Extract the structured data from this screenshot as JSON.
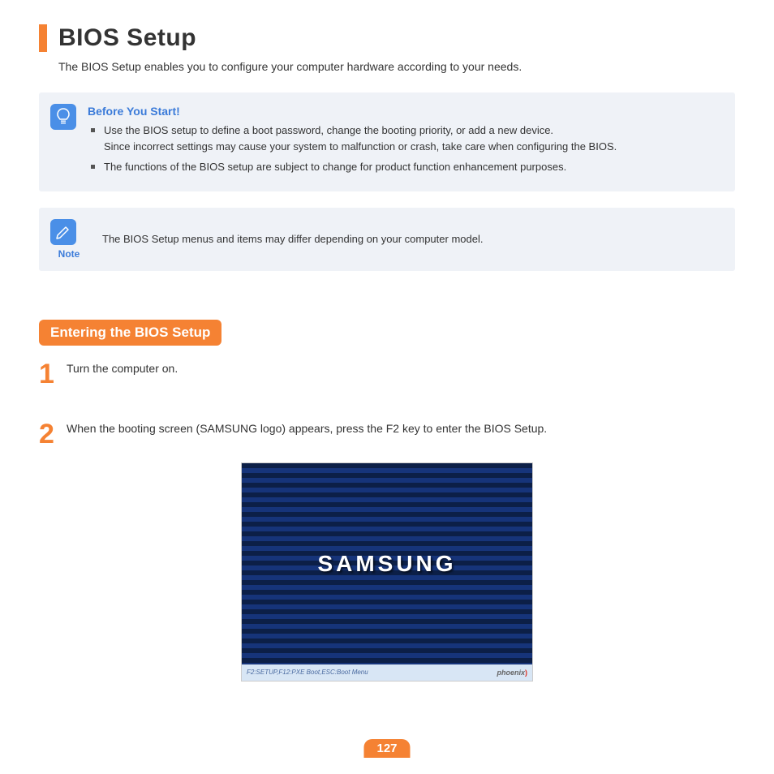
{
  "title": "BIOS Setup",
  "intro": "The BIOS Setup enables you to configure your computer hardware according to your needs.",
  "before_start": {
    "heading": "Before You Start!",
    "bullets": [
      "Use the BIOS setup to define a boot password, change the booting priority, or add a new device.\nSince incorrect settings may cause your system to malfunction or crash, take care when configuring the BIOS.",
      "The functions of the BIOS setup are subject to change for product function enhancement purposes."
    ]
  },
  "note": {
    "label": "Note",
    "text": "The BIOS Setup menus and items may differ depending on your computer model."
  },
  "section_heading": "Entering the BIOS Setup",
  "steps": [
    {
      "num": "1",
      "text": "Turn the computer on."
    },
    {
      "num": "2",
      "text": "When the booting screen (SAMSUNG logo) appears, press the F2 key to enter the BIOS Setup."
    }
  ],
  "boot": {
    "logo": "SAMSUNG",
    "footer_left": "F2:SETUP,F12:PXE Boot,ESC:Boot Menu",
    "footer_right": "phoenix"
  },
  "page_number": "127"
}
